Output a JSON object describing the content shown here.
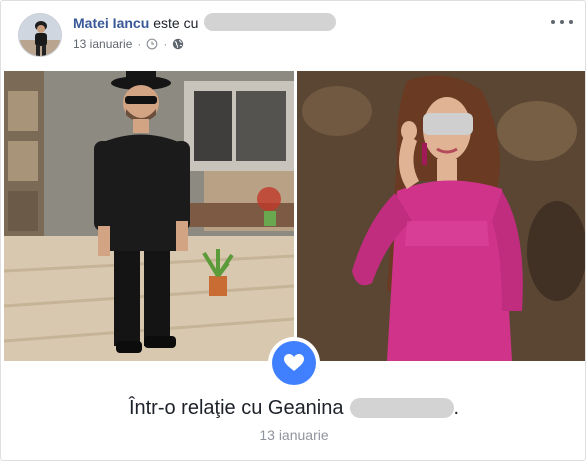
{
  "post": {
    "author": "Matei Iancu",
    "with_text": "este cu",
    "date": "13 ianuarie",
    "separator": "·",
    "icons": {
      "clock": "clock-icon",
      "audience": "globe-icon",
      "more": "more-options-icon",
      "badge": "heart-icon"
    }
  },
  "relationship": {
    "text": "Într-o relaţie cu Geanina",
    "suffix": ".",
    "date": "13 ianuarie"
  },
  "colors": {
    "author_link": "#385898",
    "badge_blue": "#4080ff",
    "secondary_text": "#90949c"
  }
}
